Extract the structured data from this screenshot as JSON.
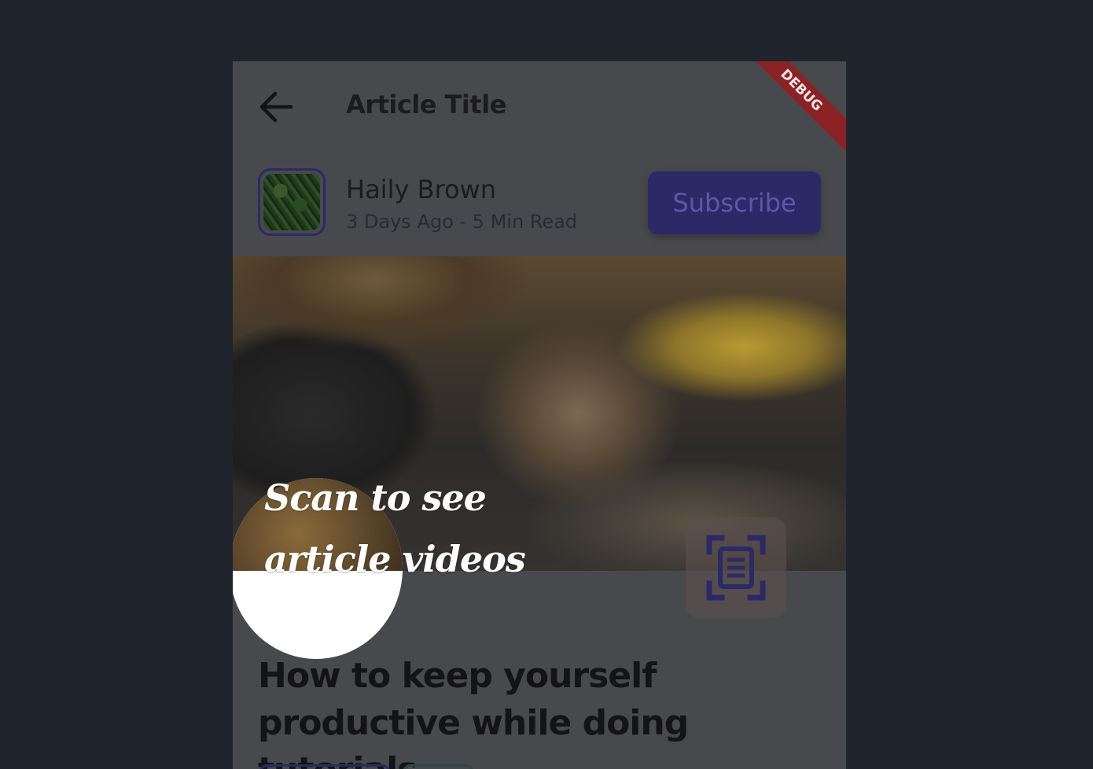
{
  "appbar": {
    "title": "Article Title",
    "back_icon": "arrow-left-icon"
  },
  "debug_banner": "DEBUG",
  "author": {
    "name": "Haily Brown",
    "meta": "3 Days Ago - 5 Min Read"
  },
  "subscribe_label": "Subscribe",
  "overlay": {
    "scan_text": "Scan to see article videos",
    "scan_icon": "document-scan-icon"
  },
  "article": {
    "title": "How to keep yourself productive while doing tutorials."
  },
  "colors": {
    "background": "#20242c",
    "accent": "#2c2a66",
    "debug": "#8b2326"
  }
}
